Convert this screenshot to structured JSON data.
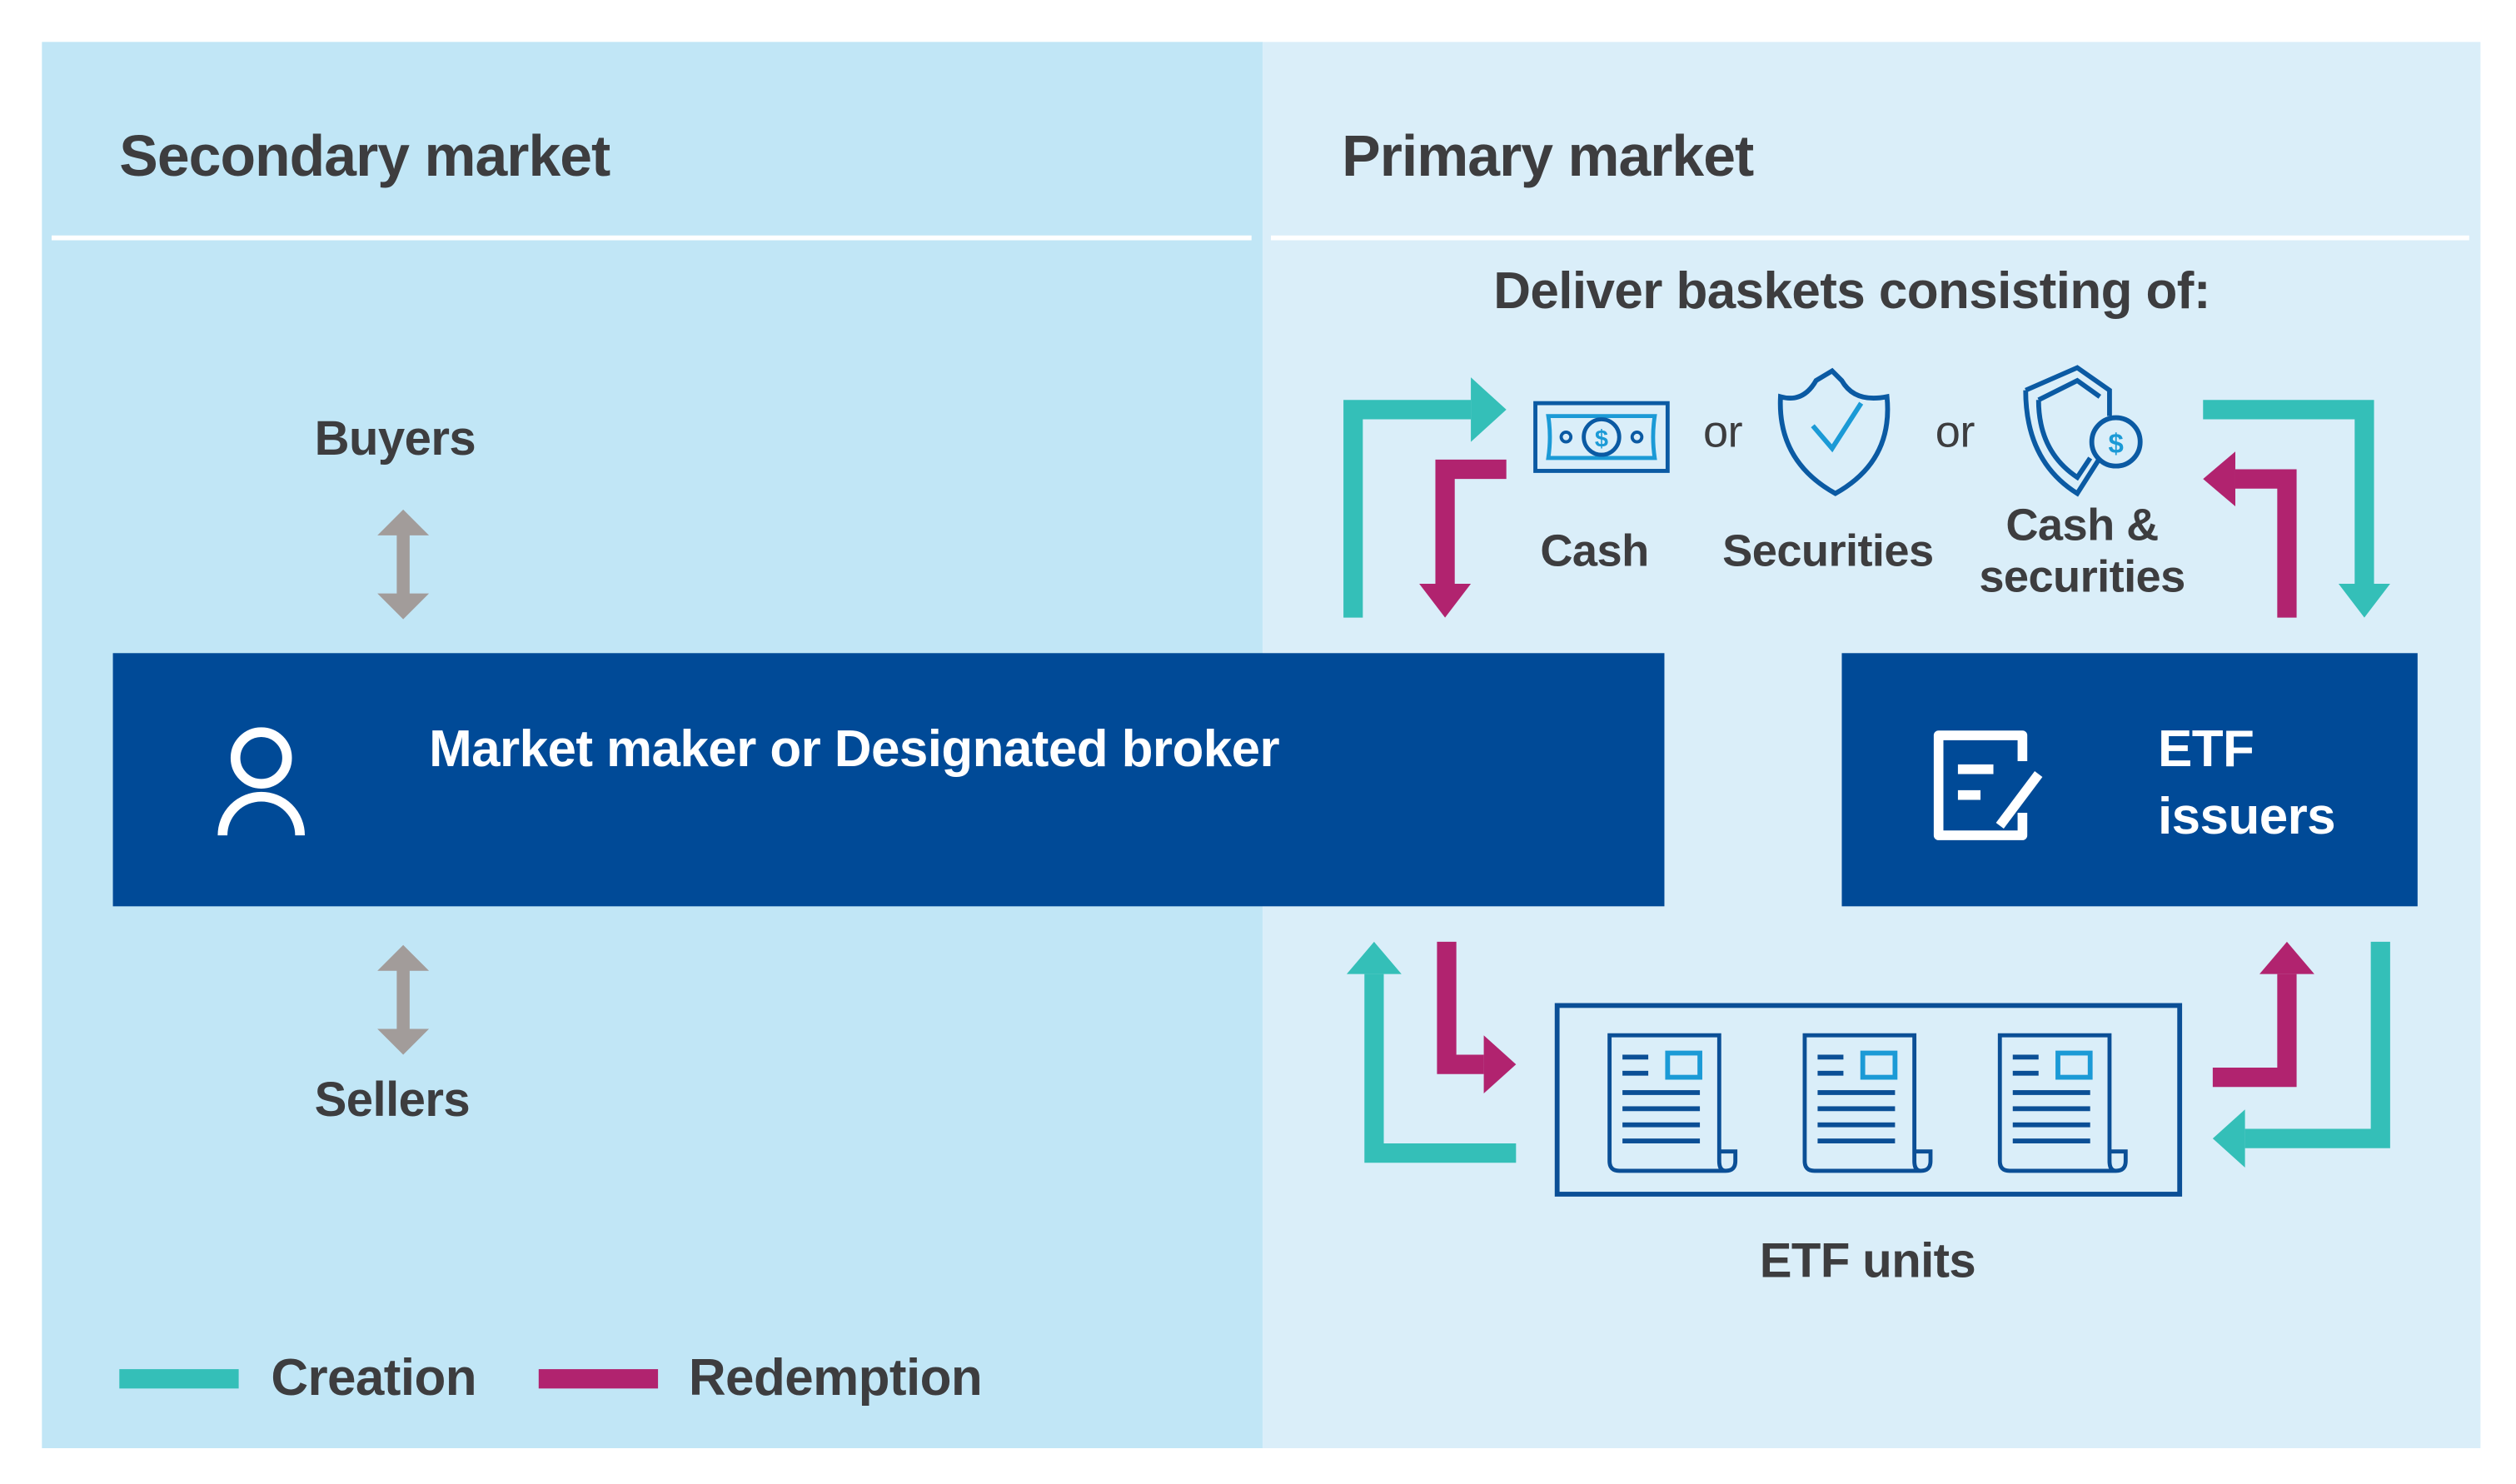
{
  "secondary": {
    "title": "Secondary market",
    "buyers": "Buyers",
    "sellers": "Sellers"
  },
  "primary": {
    "title": "Primary market",
    "baskets_heading": "Deliver baskets consisting of:",
    "or1": "or",
    "or2": "or",
    "cash": "Cash",
    "securities": "Securities",
    "cash_securities_1": "Cash &",
    "cash_securities_2": "securities",
    "etf_units": "ETF units"
  },
  "market_maker": {
    "label": "Market maker or Designated broker",
    "icon": "person-icon"
  },
  "etf_issuers": {
    "line1": "ETF",
    "line2": "issuers",
    "icon": "document-edit-icon"
  },
  "legend": {
    "creation": "Creation",
    "redemption": "Redemption"
  },
  "colors": {
    "creation": "#34bfb8",
    "redemption": "#b1236f",
    "box": "#004a97",
    "secondary_bg": "#c1e6f6",
    "primary_bg": "#daeef9",
    "neutral_arrow": "#a29c9a",
    "text": "#3d3d3f"
  }
}
